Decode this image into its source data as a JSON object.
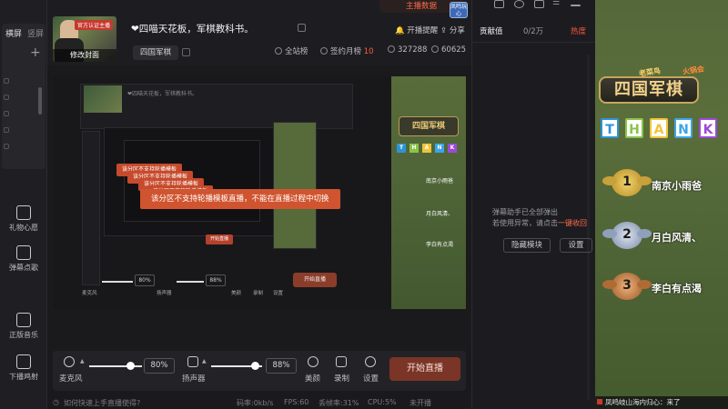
{
  "sidebar": {
    "tabs": [
      "横屏",
      "竖屏"
    ],
    "buttons": [
      {
        "label": "礼物心愿",
        "icon": "gift-icon"
      },
      {
        "label": "弹幕点歌",
        "icon": "music-request-icon"
      },
      {
        "label": "正版音乐",
        "icon": "download-music-icon"
      },
      {
        "label": "下播鸡射",
        "icon": "end-stream-icon"
      }
    ]
  },
  "header": {
    "title": "❤四喵天花板，军棋教科书。",
    "avatar_caption": "修改封面",
    "avatar_badge": "官方认证主播",
    "category": "四国军棋",
    "anchor_data_label": "主播数据",
    "live_remind": "开播提醒",
    "share": "分享",
    "station": "全站榜",
    "signed_rank_label": "签约月榜",
    "signed_rank_value": "10",
    "hot_value": "327288",
    "fans_value": "60625",
    "app_logo": "凤鸣玩心"
  },
  "preview": {
    "warning_text": "该分区不支持轮播模板直播，不能在直播过程中切换",
    "stacked_warning": "该分区不支持轮播模板",
    "inner_start": "开始直播",
    "inner_mic": "麦克风",
    "inner_speaker": "扬声器",
    "inner_beauty": "美颜",
    "inner_record": "录制",
    "inner_settings": "设置",
    "inner_pct_mic": "80%",
    "inner_pct_speaker": "88%",
    "game_logo": "四国军棋",
    "game_thank": [
      "T",
      "H",
      "A",
      "N",
      "K"
    ]
  },
  "controls": {
    "mic_label": "麦克风",
    "mic_volume": "80%",
    "speaker_label": "扬声器",
    "speaker_volume": "88%",
    "beauty_label": "美颜",
    "record_label": "录制",
    "settings_label": "设置",
    "start_label": "开始直播",
    "mic_level": 0.78,
    "speaker_level": 0.85
  },
  "footer": {
    "help": "如何快速上手直播使得?",
    "bitrate": "码率:0kb/s",
    "fps": "FPS:60",
    "dropped": "丢帧率:31%",
    "cpu": "CPU:5%",
    "status": "未开播"
  },
  "chat": {
    "tabs": {
      "contribution": "贡献值",
      "monthly": "0/2万",
      "hot": "热度"
    },
    "msg_line1": "弹幕助手已全部弹出",
    "msg_line2_prefix": "若使用异常，请点击",
    "msg_line2_link": "一键收回",
    "hide_module": "隐藏模块",
    "settings": "设置"
  },
  "game": {
    "brand_left": "老菜鸟",
    "brand_right": "火锅会",
    "logo": "四国军棋",
    "thank": [
      "T",
      "H",
      "A",
      "N",
      "K"
    ],
    "thank_colors": [
      "#2e93d6",
      "#8bc34a",
      "#f0c43a",
      "#3aa6e8",
      "#9c4ad6"
    ],
    "winners": [
      {
        "rank": "1",
        "name": "南京小雨爸"
      },
      {
        "rank": "2",
        "name": "月白风清、"
      },
      {
        "rank": "3",
        "name": "李白有点渴"
      }
    ],
    "footer_msg": "凤鸣岐山海内归心：来了"
  },
  "colors": {
    "accent": "#ff5a3c",
    "start_button": "#7a3526",
    "warning_bg": "#d0542f"
  }
}
